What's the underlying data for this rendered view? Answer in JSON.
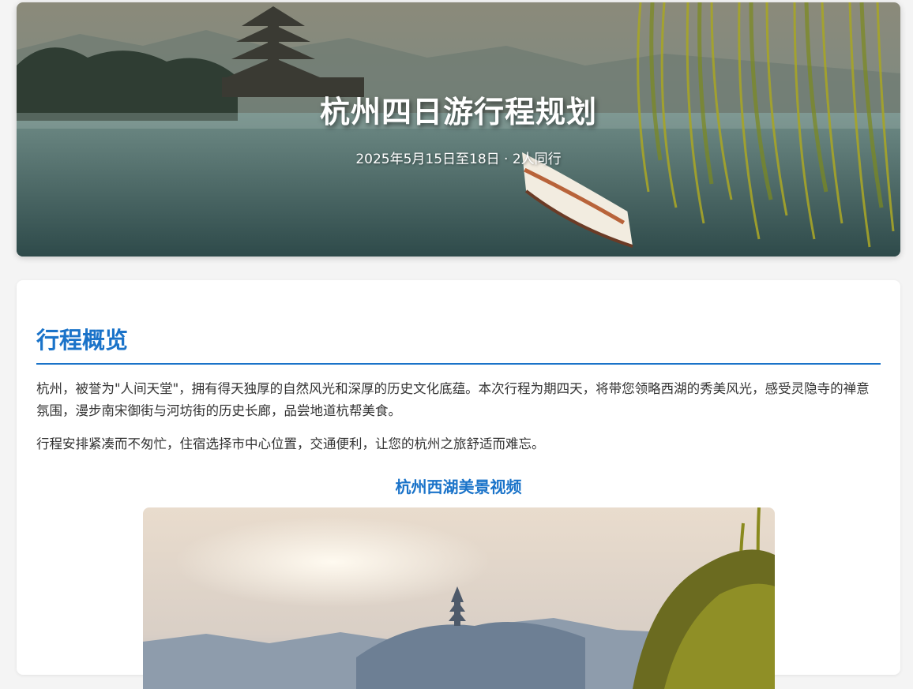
{
  "hero": {
    "title": "杭州四日游行程规划",
    "subtitle": "2025年5月15日至18日 · 2人同行"
  },
  "overview": {
    "heading": "行程概览",
    "paragraph1": "杭州，被誉为\"人间天堂\"，拥有得天独厚的自然风光和深厚的历史文化底蕴。本次行程为期四天，将带您领略西湖的秀美风光，感受灵隐寺的禅意氛围，漫步南宋御街与河坊街的历史长廊，品尝地道杭帮美食。",
    "paragraph2": "行程安排紧凑而不匆忙，住宿选择市中心位置，交通便利，让您的杭州之旅舒适而难忘。"
  },
  "video": {
    "title": "杭州西湖美景视频"
  },
  "colors": {
    "accent": "#1a73c9",
    "background": "#f4f4f4"
  }
}
